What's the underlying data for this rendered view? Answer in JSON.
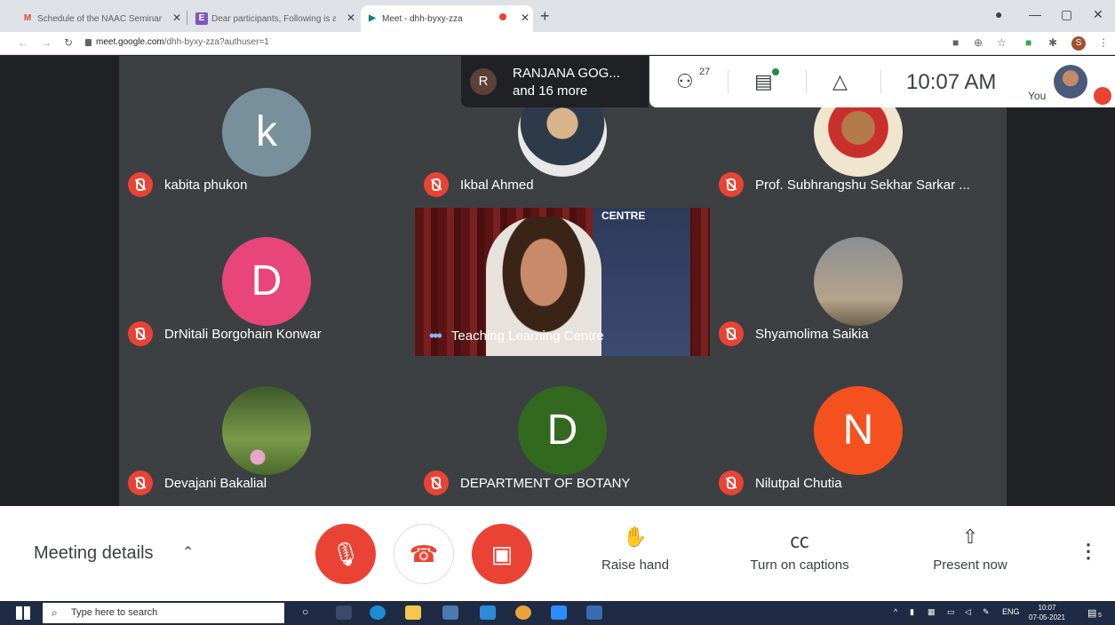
{
  "browser": {
    "tabs": [
      {
        "title": "Schedule of the NAAC Seminar",
        "favicon": "gmail-icon",
        "active": false
      },
      {
        "title": "Dear participants, Following is at",
        "favicon": "doc-icon",
        "active": false
      },
      {
        "title": "Meet - dhh-byxy-zza",
        "favicon": "meet-icon",
        "active": true
      }
    ],
    "url_host": "meet.google.com",
    "url_path": "/dhh-byxy-zza?authuser=1",
    "profile_initial": "S"
  },
  "meet": {
    "participants": [
      {
        "name": "kabita phukon",
        "initial": "k",
        "avatar_color": "#78909c"
      },
      {
        "name": "Ikbal Ahmed",
        "initial": "",
        "avatar_color": ""
      },
      {
        "name": "Prof. Subhrangshu Sekhar Sarkar ...",
        "initial": "",
        "avatar_color": ""
      },
      {
        "name": "DrNitali Borgohain Konwar",
        "initial": "D",
        "avatar_color": "#e8457b"
      },
      {
        "name": "Teaching Learning Centre",
        "initial": "",
        "avatar_color": ""
      },
      {
        "name": "Shyamolima Saikia",
        "initial": "",
        "avatar_color": ""
      },
      {
        "name": "Devajani Bakalial",
        "initial": "",
        "avatar_color": ""
      },
      {
        "name": "DEPARTMENT OF BOTANY",
        "initial": "D",
        "avatar_color": "#33691e"
      },
      {
        "name": "Nilutpal Chutia",
        "initial": "N",
        "avatar_color": "#f4511e"
      }
    ],
    "video_banner_text": "CENTRE",
    "presenter": {
      "initial": "R",
      "line1": "RANJANA GOG...",
      "line2": "and 16 more"
    },
    "people_count": "27",
    "time": "10:07 AM",
    "you_label": "You"
  },
  "controls": {
    "meeting_details": "Meeting details",
    "raise_hand": "Raise hand",
    "captions": "Turn on captions",
    "present": "Present now"
  },
  "taskbar": {
    "search_placeholder": "Type here to search",
    "lang": "ENG",
    "time": "10:07",
    "date": "07-05-2021",
    "notif_count": "5"
  }
}
